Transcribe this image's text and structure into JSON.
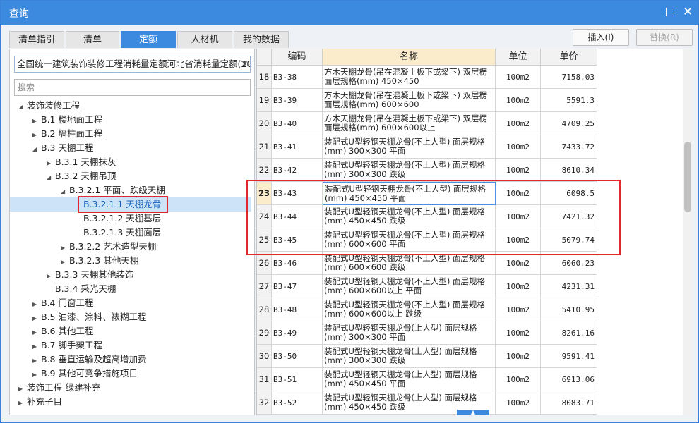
{
  "window": {
    "title": "查询"
  },
  "tabs": [
    {
      "label": "清单指引"
    },
    {
      "label": "清单"
    },
    {
      "label": "定额"
    },
    {
      "label": "人材机"
    },
    {
      "label": "我的数据"
    }
  ],
  "actions": {
    "insert_label": "插入(I)",
    "replace_label": "替换(R)"
  },
  "left": {
    "quota_select_value": "全国统一建筑装饰装修工程消耗量定额河北省消耗量定额(20",
    "search_placeholder": "搜索"
  },
  "tree": [
    {
      "label": "装饰装修工程",
      "level": 0,
      "state": "expanded"
    },
    {
      "label": "B.1 楼地面工程",
      "level": 1,
      "state": "collapsed"
    },
    {
      "label": "B.2 墙柱面工程",
      "level": 1,
      "state": "collapsed"
    },
    {
      "label": "B.3 天棚工程",
      "level": 1,
      "state": "expanded"
    },
    {
      "label": "B.3.1 天棚抹灰",
      "level": 2,
      "state": "collapsed"
    },
    {
      "label": "B.3.2 天棚吊顶",
      "level": 2,
      "state": "expanded"
    },
    {
      "label": "B.3.2.1 平面、跌级天棚",
      "level": 3,
      "state": "expanded"
    },
    {
      "label": "B.3.2.1.1 天棚龙骨",
      "level": 4,
      "state": "leaf",
      "selected": true
    },
    {
      "label": "B.3.2.1.2 天棚基层",
      "level": 4,
      "state": "leaf"
    },
    {
      "label": "B.3.2.1.3 天棚面层",
      "level": 4,
      "state": "leaf"
    },
    {
      "label": "B.3.2.2 艺术造型天棚",
      "level": 3,
      "state": "collapsed"
    },
    {
      "label": "B.3.2.3 其他天棚",
      "level": 3,
      "state": "collapsed"
    },
    {
      "label": "B.3.3 天棚其他装饰",
      "level": 2,
      "state": "collapsed"
    },
    {
      "label": "B.3.4 采光天棚",
      "level": 2,
      "state": "leaf"
    },
    {
      "label": "B.4 门窗工程",
      "level": 1,
      "state": "collapsed"
    },
    {
      "label": "B.5 油漆、涂料、裱糊工程",
      "level": 1,
      "state": "collapsed"
    },
    {
      "label": "B.6 其他工程",
      "level": 1,
      "state": "collapsed"
    },
    {
      "label": "B.7 脚手架工程",
      "level": 1,
      "state": "collapsed"
    },
    {
      "label": "B.8 垂直运输及超高增加费",
      "level": 1,
      "state": "collapsed"
    },
    {
      "label": "B.9 其他可竞争措施项目",
      "level": 1,
      "state": "collapsed"
    },
    {
      "label": "装饰工程-绿建补充",
      "level": 0,
      "state": "collapsed"
    },
    {
      "label": "补充子目",
      "level": 0,
      "state": "collapsed"
    }
  ],
  "grid": {
    "columns": [
      "编码",
      "名称",
      "单位",
      "单价"
    ],
    "rows": [
      {
        "no": "18",
        "code": "B3-38",
        "name": "方木天棚龙骨(吊在混凝土板下或梁下) 双层楞 面层规格(mm) 450×450",
        "unit": "100m2",
        "price": "7158.03"
      },
      {
        "no": "19",
        "code": "B3-39",
        "name": "方木天棚龙骨(吊在混凝土板下或梁下) 双层楞 面层规格(mm) 600×600",
        "unit": "100m2",
        "price": "5591.3"
      },
      {
        "no": "20",
        "code": "B3-40",
        "name": "方木天棚龙骨(吊在混凝土板下或梁下) 双层楞 面层规格(mm) 600×600以上",
        "unit": "100m2",
        "price": "4709.25"
      },
      {
        "no": "21",
        "code": "B3-41",
        "name": "装配式U型轻钢天棚龙骨(不上人型) 面层规格(mm) 300×300 平面",
        "unit": "100m2",
        "price": "7433.72"
      },
      {
        "no": "22",
        "code": "B3-42",
        "name": "装配式U型轻钢天棚龙骨(不上人型) 面层规格(mm) 300×300 跌级",
        "unit": "100m2",
        "price": "8610.34"
      },
      {
        "no": "23",
        "code": "B3-43",
        "name": "装配式U型轻钢天棚龙骨(不上人型) 面层规格(mm) 450×450 平面",
        "unit": "100m2",
        "price": "6098.5",
        "highlight": true
      },
      {
        "no": "24",
        "code": "B3-44",
        "name": "装配式U型轻钢天棚龙骨(不上人型) 面层规格(mm) 450×450 跌级",
        "unit": "100m2",
        "price": "7421.32"
      },
      {
        "no": "25",
        "code": "B3-45",
        "name": "装配式U型轻钢天棚龙骨(不上人型) 面层规格(mm) 600×600 平面",
        "unit": "100m2",
        "price": "5079.74"
      },
      {
        "no": "26",
        "code": "B3-46",
        "name": "装配式U型轻钢天棚龙骨(不上人型) 面层规格(mm) 600×600 跌级",
        "unit": "100m2",
        "price": "6060.23"
      },
      {
        "no": "27",
        "code": "B3-47",
        "name": "装配式U型轻钢天棚龙骨(不上人型) 面层规格(mm) 600×600以上 平面",
        "unit": "100m2",
        "price": "4231.31"
      },
      {
        "no": "28",
        "code": "B3-48",
        "name": "装配式U型轻钢天棚龙骨(不上人型) 面层规格(mm) 600×600以上 跌级",
        "unit": "100m2",
        "price": "5410.95"
      },
      {
        "no": "29",
        "code": "B3-49",
        "name": "装配式U型轻钢天棚龙骨(上人型) 面层规格(mm) 300×300 平面",
        "unit": "100m2",
        "price": "8261.16"
      },
      {
        "no": "30",
        "code": "B3-50",
        "name": "装配式U型轻钢天棚龙骨(上人型) 面层规格(mm) 300×300 跌级",
        "unit": "100m2",
        "price": "9591.41"
      },
      {
        "no": "31",
        "code": "B3-51",
        "name": "装配式U型轻钢天棚龙骨(上人型) 面层规格(mm) 450×450 平面",
        "unit": "100m2",
        "price": "6913.06"
      },
      {
        "no": "32",
        "code": "B3-52",
        "name": "装配式U型轻钢天棚龙骨(上人型) 面层规格(mm) 450×450 跌级",
        "unit": "100m2",
        "price": "8083.71"
      }
    ]
  },
  "colors": {
    "accent": "#3c8ae0",
    "highlight_box": "#e0282e",
    "header_name_bg": "#fbeccc",
    "selected_node_bg": "#cde3f7"
  }
}
